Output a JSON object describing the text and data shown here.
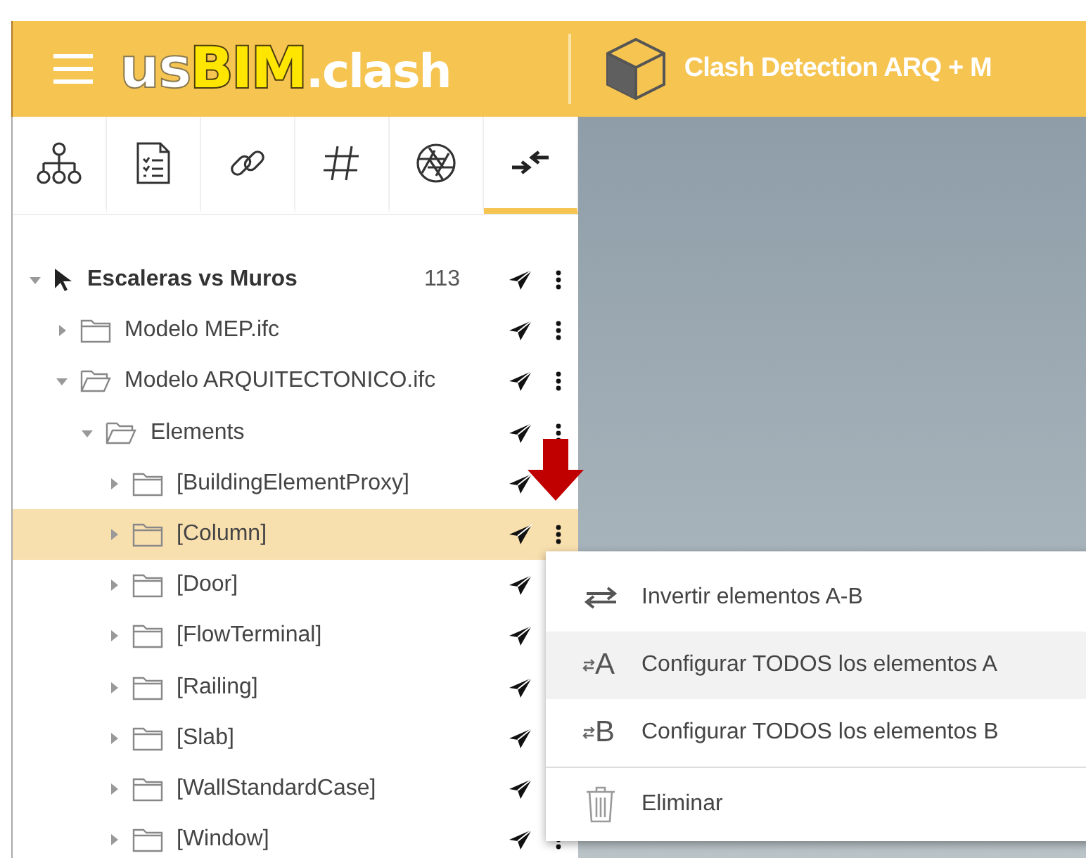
{
  "header": {
    "logo": {
      "prefix": "us",
      "main": "BIM",
      "suffix": ".clash"
    },
    "project_title": "Clash Detection ARQ + M"
  },
  "tabs": [
    {
      "selected": false
    },
    {
      "selected": false
    },
    {
      "selected": false
    },
    {
      "selected": false
    },
    {
      "selected": false
    },
    {
      "selected": true
    }
  ],
  "tree": [
    {
      "kind": "test",
      "label": "Escaleras vs Muros",
      "count": "113",
      "expanded": true,
      "selected": false,
      "children": [
        {
          "kind": "folder",
          "label": "Modelo MEP.ifc",
          "expanded": false,
          "selected": false
        },
        {
          "kind": "folder",
          "label": "Modelo ARQUITECTONICO.ifc",
          "expanded": true,
          "selected": false,
          "children": [
            {
              "kind": "folder",
              "label": "Elements",
              "expanded": true,
              "selected": false,
              "children": [
                {
                  "kind": "folder",
                  "label": "[BuildingElementProxy]",
                  "expanded": false,
                  "selected": false
                },
                {
                  "kind": "folder",
                  "label": "[Column]",
                  "expanded": false,
                  "selected": true
                },
                {
                  "kind": "folder",
                  "label": "[Door]",
                  "expanded": false,
                  "selected": false
                },
                {
                  "kind": "folder",
                  "label": "[FlowTerminal]",
                  "expanded": false,
                  "selected": false
                },
                {
                  "kind": "folder",
                  "label": "[Railing]",
                  "expanded": false,
                  "selected": false
                },
                {
                  "kind": "folder",
                  "label": "[Slab]",
                  "expanded": false,
                  "selected": false
                },
                {
                  "kind": "folder",
                  "label": "[WallStandardCase]",
                  "expanded": false,
                  "selected": false
                },
                {
                  "kind": "folder",
                  "label": "[Window]",
                  "expanded": false,
                  "selected": false
                }
              ]
            }
          ]
        }
      ]
    }
  ],
  "context_menu": [
    {
      "kind": "invert",
      "label": "Invertir elementos A-B",
      "selected": false
    },
    {
      "kind": "set",
      "letter": "A",
      "label": "Configurar TODOS los elementos A",
      "selected": true
    },
    {
      "kind": "set",
      "letter": "B",
      "label": "Configurar TODOS los elementos B",
      "selected": false
    },
    {
      "kind": "delete",
      "label": "Eliminar",
      "selected": false
    }
  ]
}
